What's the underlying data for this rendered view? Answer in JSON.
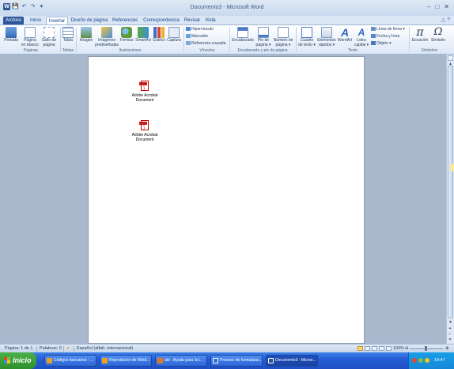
{
  "window": {
    "title": "Documento3 - Microsoft Word",
    "controls": [
      "–",
      "□",
      "✕"
    ]
  },
  "quick_access": [
    "W",
    "💾",
    "↶",
    "↷",
    "▾"
  ],
  "tabs": [
    {
      "label": "Archivo"
    },
    {
      "label": "Inicio"
    },
    {
      "label": "Insertar"
    },
    {
      "label": "Diseño de página"
    },
    {
      "label": "Referencias"
    },
    {
      "label": "Correspondencia"
    },
    {
      "label": "Revisar"
    },
    {
      "label": "Vista"
    }
  ],
  "active_tab": "Insertar",
  "ribbon": {
    "paginas": {
      "portada": "Portada",
      "pagina_en_blanco": [
        "Página",
        "en blanco"
      ],
      "salto_pagina": [
        "Salto de",
        "página"
      ],
      "group": "Páginas"
    },
    "tablas": {
      "tabla": "Tabla",
      "group": "Tablas"
    },
    "ilustraciones": {
      "imagen": "Imagen",
      "imagenes_pred": [
        "Imágenes",
        "prediseñadas"
      ],
      "formas": "Formas",
      "smartart": "SmartArt",
      "grafico": "Gráfico",
      "captura": "Captura",
      "group": "Ilustraciones"
    },
    "vinculos": {
      "hipervinculo": "Hipervínculo",
      "marcador": "Marcador",
      "ref_cruzada": "Referencia cruzada",
      "group": "Vínculos"
    },
    "encabezado": {
      "encabezado": "Encabezado",
      "pie_pagina": [
        "Pie de",
        "página ▾"
      ],
      "numero_pagina": [
        "Número de",
        "página ▾"
      ],
      "group": "Encabezado y pie de página"
    },
    "texto": {
      "cuadro_texto": [
        "Cuadro",
        "de texto ▾"
      ],
      "elementos_rapidos": [
        "Elementos",
        "rápidos ▾"
      ],
      "wordart": "WordArt",
      "letra_capital": [
        "Letra",
        "capital ▾"
      ],
      "linea_firma": "Línea de firma ▾",
      "fecha_hora": "Fecha y hora",
      "objeto": "Objeto ▾",
      "group": "Texto"
    },
    "simbolos": {
      "ecuacion": "Ecuación",
      "simbolo": "Símbolo",
      "group": "Símbolos"
    }
  },
  "document": {
    "objects": [
      {
        "line1": "Adobe Acrobat",
        "line2": "Document"
      },
      {
        "line1": "Adobe Acrobat",
        "line2": "Document"
      }
    ]
  },
  "statusbar": {
    "page": "Página: 1 de 1",
    "words": "Palabras: 0",
    "language": "Español (alfab. internacional)",
    "zoom": "100%",
    "zoom_level_percent": 100
  },
  "taskbar": {
    "start": "Inicio",
    "tasks": [
      {
        "label": "Códigos bancarios - ...",
        "color": "#e8a028"
      },
      {
        "label": "Reproductor de Wind...",
        "color": "#f2a31b"
      },
      {
        "label": "ate : Ayuda para la l...",
        "color": "#e07a1a"
      },
      {
        "label": "Proceso de formalizac...",
        "color": "#2e6fd8"
      },
      {
        "label": "Documento3 - Micros...",
        "color": "#2b579a"
      }
    ],
    "clock": "14:47"
  }
}
